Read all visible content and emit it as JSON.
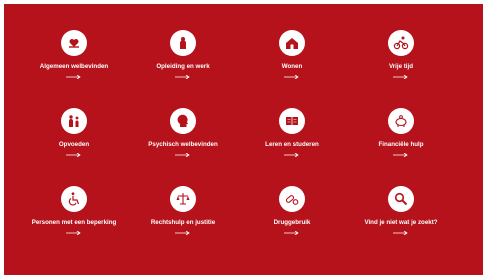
{
  "colors": {
    "background": "#b5121b",
    "icon_bg": "#ffffff",
    "text": "#ffffff"
  },
  "tiles": [
    {
      "label": "Algemeen welbevinden",
      "icon": "heart-hands-icon"
    },
    {
      "label": "Opleiding en werk",
      "icon": "person-icon"
    },
    {
      "label": "Wonen",
      "icon": "house-icon"
    },
    {
      "label": "Vrije tijd",
      "icon": "cyclist-icon"
    },
    {
      "label": "Opvoeden",
      "icon": "family-icon"
    },
    {
      "label": "Psychisch welbevinden",
      "icon": "head-icon"
    },
    {
      "label": "Leren en studeren",
      "icon": "book-icon"
    },
    {
      "label": "Financiële hulp",
      "icon": "piggy-bank-icon"
    },
    {
      "label": "Personen met een beperking",
      "icon": "wheelchair-icon"
    },
    {
      "label": "Rechtshulp en justitie",
      "icon": "scales-icon"
    },
    {
      "label": "Druggebruik",
      "icon": "pills-icon"
    },
    {
      "label": "Vind je niet wat je zoekt?",
      "icon": "search-icon"
    }
  ]
}
